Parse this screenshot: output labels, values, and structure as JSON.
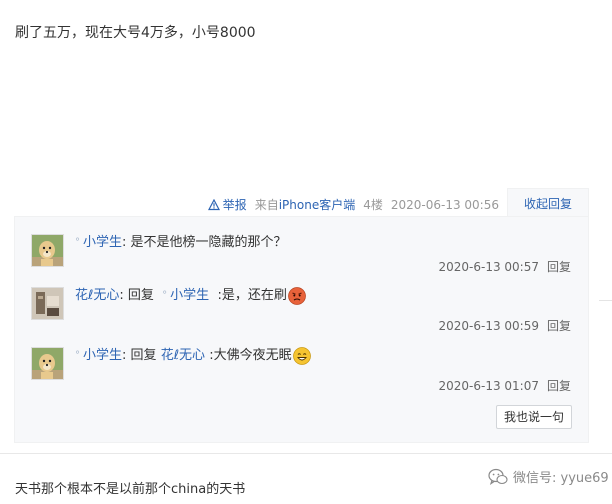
{
  "post": {
    "body_text": "刷了五万，现在大号4万多，小号8000"
  },
  "tail": {
    "report_label": "举报",
    "source_prefix": "来自",
    "source_client": "iPhone客户端",
    "floor": "4楼",
    "timestamp": "2020-06-13 00:56",
    "collapse_label": "收起回复"
  },
  "replies": [
    {
      "user": "小学生",
      "text": ": 是不是他榜一隐藏的那个？",
      "time": "2020-6-13 00:57",
      "reply_label": "回复"
    },
    {
      "user": "花ℓ无心",
      "reply_word": "回复",
      "target_user": "小学生",
      "text": ":是，还在刷",
      "time": "2020-6-13 00:59",
      "reply_label": "回复"
    },
    {
      "user": "小学生",
      "reply_word": "回复",
      "target_user": "花ℓ无心",
      "text": ":大佛今夜无眠",
      "time": "2020-6-13 01:07",
      "reply_label": "回复"
    }
  ],
  "say_button_label": "我也说一句",
  "next_post": {
    "body_text": "天书那个根本不是以前那个china的天书"
  },
  "watermark": {
    "text": "微信号: yyue69",
    "icon": "wechat-icon"
  },
  "colors": {
    "link": "#2d64b3",
    "meta": "#999999",
    "reply_bg": "#f7f8fa"
  }
}
